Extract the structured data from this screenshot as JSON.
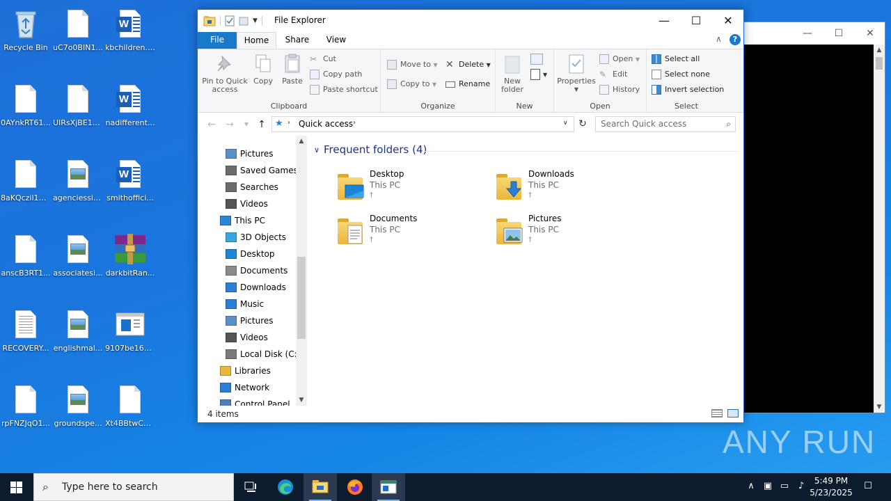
{
  "desktop": {
    "icons": [
      {
        "label": "Recycle Bin",
        "type": "recycle"
      },
      {
        "label": "uC7o0BIN1...",
        "type": "blank"
      },
      {
        "label": "kbchildren.rtf",
        "type": "word"
      },
      {
        "label": "0AYnkRT61...",
        "type": "blank"
      },
      {
        "label": "UIRsXjBE17...",
        "type": "blank"
      },
      {
        "label": "nadifferent...",
        "type": "word"
      },
      {
        "label": "8aKQczil17...",
        "type": "blank"
      },
      {
        "label": "agenciessix...",
        "type": "image"
      },
      {
        "label": "smithoffici...",
        "type": "word"
      },
      {
        "label": "anscB3RT1...",
        "type": "blank"
      },
      {
        "label": "associatesi...",
        "type": "image"
      },
      {
        "label": "darkbitRan...",
        "type": "winrar"
      },
      {
        "label": "RECOVERY...",
        "type": "text"
      },
      {
        "label": "englishmal...",
        "type": "image"
      },
      {
        "label": "9107be160f...",
        "type": "app"
      },
      {
        "label": "rpFNZJqO1...",
        "type": "blank"
      },
      {
        "label": "groundspe...",
        "type": "image"
      },
      {
        "label": "Xt4BBtwC1...",
        "type": "blank"
      }
    ]
  },
  "explorer": {
    "title": "File Explorer",
    "tabs": {
      "file": "File",
      "home": "Home",
      "share": "Share",
      "view": "View"
    },
    "ribbon": {
      "clipboard": {
        "label": "Clipboard",
        "pin_line1": "Pin to Quick",
        "pin_line2": "access",
        "copy": "Copy",
        "paste": "Paste",
        "cut": "Cut",
        "copy_path": "Copy path",
        "paste_shortcut": "Paste shortcut"
      },
      "organize": {
        "label": "Organize",
        "move_to": "Move to",
        "copy_to": "Copy to",
        "delete": "Delete",
        "rename": "Rename"
      },
      "new": {
        "label": "New",
        "new_folder_line1": "New",
        "new_folder_line2": "folder"
      },
      "open": {
        "label": "Open",
        "properties": "Properties",
        "open": "Open",
        "edit": "Edit",
        "history": "History"
      },
      "select": {
        "label": "Select",
        "select_all": "Select all",
        "select_none": "Select none",
        "invert": "Invert selection"
      }
    },
    "address": {
      "crumb": "Quick access",
      "search_placeholder": "Search Quick access"
    },
    "nav": [
      {
        "label": "Pictures",
        "indent": 1,
        "icon": "pictures"
      },
      {
        "label": "Saved Games",
        "indent": 1,
        "icon": "games"
      },
      {
        "label": "Searches",
        "indent": 1,
        "icon": "search"
      },
      {
        "label": "Videos",
        "indent": 1,
        "icon": "videos"
      },
      {
        "label": "This PC",
        "indent": 0,
        "icon": "pc"
      },
      {
        "label": "3D Objects",
        "indent": 1,
        "icon": "3d"
      },
      {
        "label": "Desktop",
        "indent": 1,
        "icon": "desktop"
      },
      {
        "label": "Documents",
        "indent": 1,
        "icon": "documents"
      },
      {
        "label": "Downloads",
        "indent": 1,
        "icon": "downloads"
      },
      {
        "label": "Music",
        "indent": 1,
        "icon": "music"
      },
      {
        "label": "Pictures",
        "indent": 1,
        "icon": "pictures"
      },
      {
        "label": "Videos",
        "indent": 1,
        "icon": "videos"
      },
      {
        "label": "Local Disk (C:)",
        "indent": 1,
        "icon": "disk"
      },
      {
        "label": "Libraries",
        "indent": 0,
        "icon": "libraries"
      },
      {
        "label": "Network",
        "indent": 0,
        "icon": "network"
      },
      {
        "label": "Control Panel",
        "indent": 0,
        "icon": "control"
      }
    ],
    "section": "Frequent folders (4)",
    "folders": [
      {
        "name": "Desktop",
        "sub": "This PC",
        "overlay": "desktop"
      },
      {
        "name": "Downloads",
        "sub": "This PC",
        "overlay": "downloads"
      },
      {
        "name": "Documents",
        "sub": "This PC",
        "overlay": "documents"
      },
      {
        "name": "Pictures",
        "sub": "This PC",
        "overlay": "pictures"
      }
    ],
    "status": "4 items"
  },
  "taskbar": {
    "search_placeholder": "Type here to search",
    "time": "5:49 PM",
    "date": "5/23/2025",
    "apps": [
      "task-view",
      "edge",
      "file-explorer",
      "firefox",
      "app"
    ]
  },
  "watermark": "ANY RUN",
  "colors": {
    "accent": "#1979ca",
    "taskbar": "#0d1b2e",
    "folder": "#f8d775",
    "section_header": "#1e3287"
  }
}
